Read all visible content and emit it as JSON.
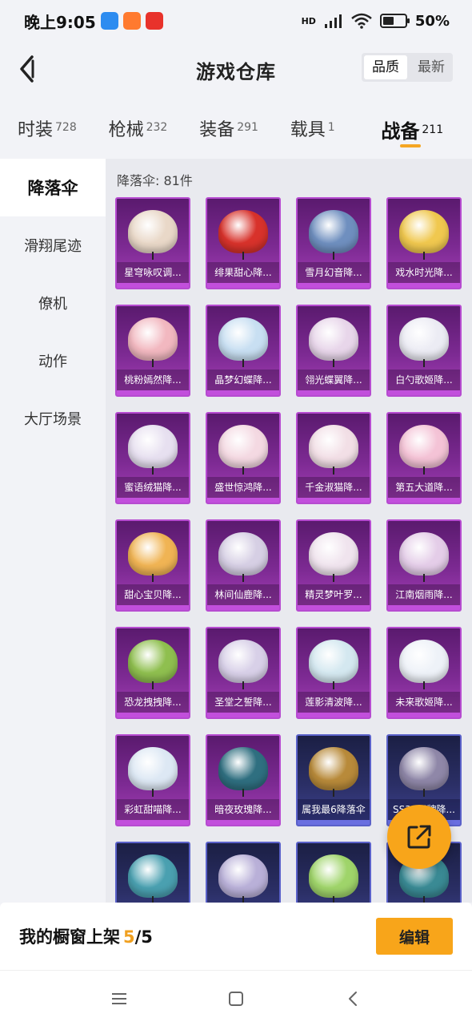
{
  "status_bar": {
    "time": "晚上9:05",
    "battery_text": "50%",
    "battery_level": 0.5,
    "network": "HD"
  },
  "header": {
    "title": "游戏仓库",
    "sort_options": [
      "品质",
      "最新"
    ],
    "sort_selected": "品质"
  },
  "categories": [
    {
      "label": "时装",
      "count": "728",
      "active": false
    },
    {
      "label": "枪械",
      "count": "232",
      "active": false
    },
    {
      "label": "装备",
      "count": "291",
      "active": false
    },
    {
      "label": "载具",
      "count": "1",
      "active": false
    },
    {
      "label": "战备",
      "count": "211",
      "active": true
    }
  ],
  "sidenav": [
    {
      "label": "降落伞",
      "active": true
    },
    {
      "label": "滑翔尾迹",
      "active": false
    },
    {
      "label": "僚机",
      "active": false
    },
    {
      "label": "动作",
      "active": false
    },
    {
      "label": "大厅场景",
      "active": false
    }
  ],
  "content": {
    "count_label": "降落伞: 81件",
    "items": [
      {
        "name": "星穹咏叹调...",
        "tier": "purple",
        "color": "#e9d8c8"
      },
      {
        "name": "绯果甜心降...",
        "tier": "purple",
        "color": "#d8322b"
      },
      {
        "name": "雪月幻音降...",
        "tier": "purple",
        "color": "#6f8fbf"
      },
      {
        "name": "戏水时光降...",
        "tier": "purple",
        "color": "#f0c84f"
      },
      {
        "name": "桃粉嫣然降...",
        "tier": "purple",
        "color": "#f2b8c0"
      },
      {
        "name": "晶梦幻蝶降...",
        "tier": "purple",
        "color": "#c8dff2"
      },
      {
        "name": "翎光蝶翼降...",
        "tier": "purple",
        "color": "#e8d6ea"
      },
      {
        "name": "白勺歌姬降...",
        "tier": "purple",
        "color": "#ececf4"
      },
      {
        "name": "蜜语绒猫降...",
        "tier": "purple",
        "color": "#e7e0f0"
      },
      {
        "name": "盛世惊鸿降...",
        "tier": "purple",
        "color": "#f4d9e2"
      },
      {
        "name": "千金淑猫降...",
        "tier": "purple",
        "color": "#f2dfe6"
      },
      {
        "name": "第五大道降...",
        "tier": "purple",
        "color": "#f4c3d6"
      },
      {
        "name": "甜心宝贝降...",
        "tier": "purple",
        "color": "#f0b454"
      },
      {
        "name": "林间仙鹿降...",
        "tier": "purple",
        "color": "#d6cfe4"
      },
      {
        "name": "精灵梦叶罗...",
        "tier": "purple",
        "color": "#f0e4ee"
      },
      {
        "name": "江南烟雨降...",
        "tier": "purple",
        "color": "#e4cde8"
      },
      {
        "name": "恐龙拽拽降...",
        "tier": "purple",
        "color": "#8fbf4f"
      },
      {
        "name": "圣堂之誓降...",
        "tier": "purple",
        "color": "#d8d0e8"
      },
      {
        "name": "莲影清波降...",
        "tier": "purple",
        "color": "#d4e8f0"
      },
      {
        "name": "未来歌姬降...",
        "tier": "purple",
        "color": "#eef2f8"
      },
      {
        "name": "彩虹甜喵降...",
        "tier": "purple",
        "color": "#dde8f4"
      },
      {
        "name": "暗夜玫瑰降...",
        "tier": "purple",
        "color": "#2f6f80"
      },
      {
        "name": "属我最6降落伞",
        "tier": "blue",
        "color": "#b88a3a"
      },
      {
        "name": "SS32王牌降...",
        "tier": "blue",
        "color": "#8f87a8"
      },
      {
        "name": "",
        "tier": "blue",
        "color": "#4aa0b0"
      },
      {
        "name": "",
        "tier": "blue",
        "color": "#b9b0d8"
      },
      {
        "name": "",
        "tier": "blue",
        "color": "#9fd46a"
      },
      {
        "name": "",
        "tier": "blue",
        "color": "#3a8a94"
      }
    ]
  },
  "showcase": {
    "title": "我的橱窗上架",
    "current": "5",
    "separator": "/",
    "total": "5",
    "edit_label": "编辑"
  },
  "colors": {
    "accent": "#f8a51a",
    "purple_card": "#7d2a93",
    "blue_card": "#2b2f66"
  }
}
